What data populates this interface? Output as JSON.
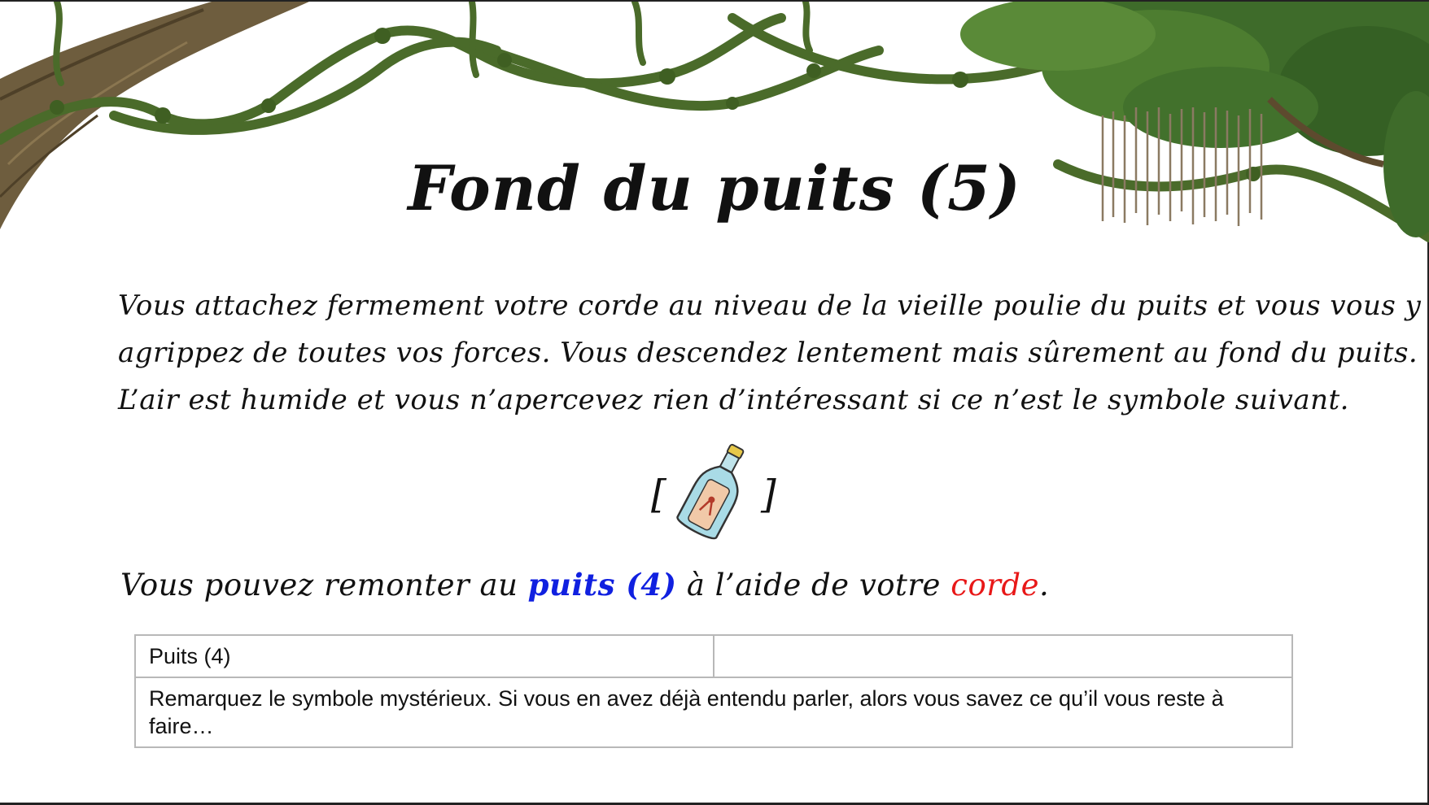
{
  "page": {
    "title": "Fond du puits (5)",
    "paragraph_lines": [
      "Vous attachez fermement votre corde au niveau de la vieille poulie du puits et vous vous y",
      "agrippez de toutes vos forces. Vous descendez lentement mais sûrement au fond du puits.",
      "L’air est humide et vous n’apercevez rien d’intéressant si ce n’est le symbole suivant."
    ],
    "symbol": {
      "open_bracket": "[",
      "close_bracket": "]",
      "icon": "message-in-bottle-icon"
    },
    "navigation": {
      "prefix": "Vous pouvez remonter au ",
      "link_label": "puits (4)",
      "middle": " à l’aide de votre ",
      "item_label": "corde",
      "suffix": "."
    },
    "hint_table": {
      "header_cells": [
        "Puits (4)",
        ""
      ],
      "hint_text": "Remarquez le symbole mystérieux. Si vous en avez déjà entendu parler, alors vous savez ce qu’il vous reste à faire…"
    }
  },
  "colors": {
    "link": "#1020e0",
    "item": "#e81818",
    "foliage": "#3e6b2a",
    "trunk": "#6b5a3a"
  }
}
